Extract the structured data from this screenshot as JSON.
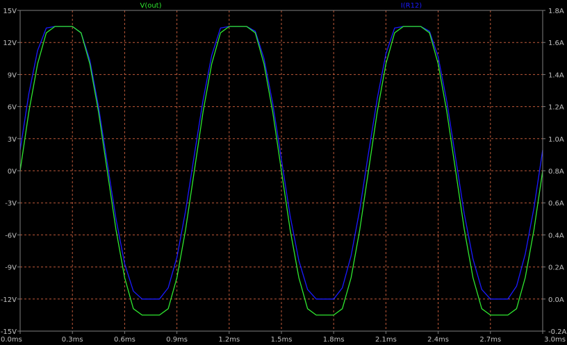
{
  "chart_data": {
    "type": "line",
    "title": "",
    "xlabel": "",
    "ylabel": "",
    "x_unit": "ms",
    "xlim": [
      0,
      3.0
    ],
    "ylim_left": [
      -15,
      15
    ],
    "ylim_right": [
      -0.2,
      1.8
    ],
    "grid": true,
    "x_ticks": [
      "0.0ms",
      "0.3ms",
      "0.6ms",
      "0.9ms",
      "1.2ms",
      "1.5ms",
      "1.8ms",
      "2.1ms",
      "2.4ms",
      "2.7ms",
      "3.0ms"
    ],
    "y_left_ticks": [
      "15V",
      "12V",
      "9V",
      "6V",
      "3V",
      "0V",
      "-3V",
      "-6V",
      "-9V",
      "-12V",
      "-15V"
    ],
    "y_right_ticks": [
      "1.8A",
      "1.6A",
      "1.4A",
      "1.2A",
      "1.0A",
      "0.8A",
      "0.6A",
      "0.4A",
      "0.2A",
      "0.0A",
      "-0.2A"
    ],
    "colors": {
      "background": "#000000",
      "grid": "#c05a3a",
      "axis": "#808080",
      "tick_text": "#c0c0c0"
    },
    "series": [
      {
        "name": "V(out)",
        "axis": "left",
        "unit": "V",
        "color": "#2fe82f",
        "x": [
          0.0,
          0.05,
          0.1,
          0.15,
          0.2,
          0.25,
          0.3,
          0.35,
          0.4,
          0.45,
          0.5,
          0.55,
          0.6,
          0.65,
          0.7,
          0.75,
          0.8,
          0.85,
          0.9,
          0.95,
          1.0,
          1.05,
          1.1,
          1.15,
          1.2,
          1.25,
          1.3,
          1.35,
          1.4,
          1.45,
          1.5,
          1.55,
          1.6,
          1.65,
          1.7,
          1.75,
          1.8,
          1.85,
          1.9,
          1.95,
          2.0,
          2.05,
          2.1,
          2.15,
          2.2,
          2.25,
          2.3,
          2.35,
          2.4,
          2.45,
          2.5,
          2.55,
          2.6,
          2.65,
          2.7,
          2.75,
          2.8,
          2.85,
          2.9,
          2.95,
          3.0
        ],
        "values": [
          0.0,
          5.5,
          10.0,
          12.9,
          13.5,
          13.5,
          13.5,
          12.9,
          10.0,
          5.5,
          0.0,
          -5.5,
          -10.0,
          -12.9,
          -13.5,
          -13.5,
          -13.5,
          -12.9,
          -10.0,
          -5.5,
          0.0,
          5.5,
          10.0,
          12.9,
          13.5,
          13.5,
          13.5,
          12.9,
          10.0,
          5.5,
          0.0,
          -5.5,
          -10.0,
          -12.9,
          -13.5,
          -13.5,
          -13.5,
          -12.9,
          -10.0,
          -5.5,
          0.0,
          5.5,
          10.0,
          12.9,
          13.5,
          13.5,
          13.5,
          12.9,
          10.0,
          5.5,
          0.0,
          -5.5,
          -10.0,
          -12.9,
          -13.5,
          -13.5,
          -13.5,
          -12.9,
          -10.0,
          -5.5,
          0.0
        ]
      },
      {
        "name": "I(R12)",
        "axis": "right",
        "unit": "A",
        "color": "#1a1aff",
        "x": [
          0.0,
          0.05,
          0.1,
          0.15,
          0.2,
          0.25,
          0.3,
          0.35,
          0.4,
          0.45,
          0.5,
          0.55,
          0.6,
          0.65,
          0.7,
          0.75,
          0.8,
          0.85,
          0.9,
          0.95,
          1.0,
          1.05,
          1.1,
          1.15,
          1.2,
          1.25,
          1.3,
          1.35,
          1.4,
          1.45,
          1.5,
          1.55,
          1.6,
          1.65,
          1.7,
          1.75,
          1.8,
          1.85,
          1.9,
          1.95,
          2.0,
          2.05,
          2.1,
          2.15,
          2.2,
          2.25,
          2.3,
          2.35,
          2.4,
          2.45,
          2.5,
          2.55,
          2.6,
          2.65,
          2.7,
          2.75,
          2.8,
          2.85,
          2.9,
          2.95,
          3.0
        ],
        "values": [
          0.93,
          1.28,
          1.55,
          1.69,
          1.7,
          1.7,
          1.7,
          1.66,
          1.49,
          1.2,
          0.85,
          0.5,
          0.22,
          0.05,
          0.0,
          0.0,
          0.0,
          0.07,
          0.26,
          0.55,
          0.9,
          1.24,
          1.52,
          1.69,
          1.7,
          1.7,
          1.7,
          1.67,
          1.5,
          1.22,
          0.87,
          0.52,
          0.24,
          0.06,
          0.0,
          0.0,
          0.0,
          0.07,
          0.27,
          0.56,
          0.91,
          1.25,
          1.53,
          1.69,
          1.7,
          1.7,
          1.7,
          1.67,
          1.51,
          1.23,
          0.88,
          0.53,
          0.25,
          0.06,
          0.0,
          0.0,
          0.0,
          0.08,
          0.28,
          0.57,
          0.93
        ]
      }
    ]
  }
}
